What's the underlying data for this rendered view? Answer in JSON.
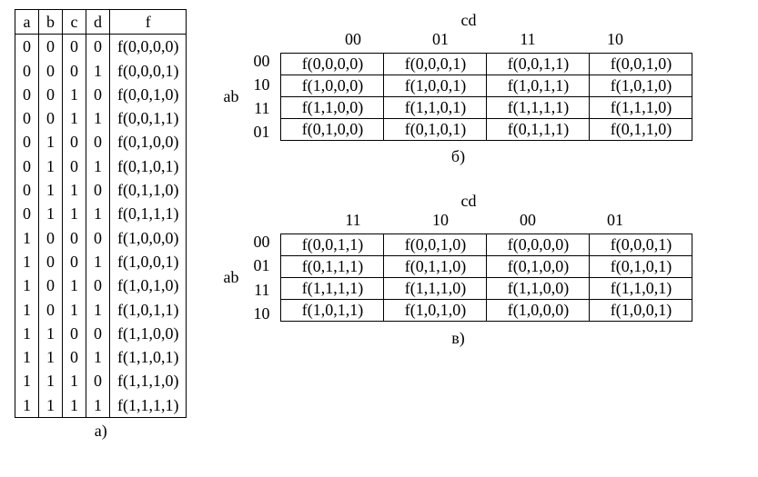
{
  "truth_table": {
    "headers": [
      "a",
      "b",
      "c",
      "d",
      "f"
    ],
    "rows": [
      {
        "a": "0",
        "b": "0",
        "c": "0",
        "d": "0",
        "f": "f(0,0,0,0)"
      },
      {
        "a": "0",
        "b": "0",
        "c": "0",
        "d": "1",
        "f": "f(0,0,0,1)"
      },
      {
        "a": "0",
        "b": "0",
        "c": "1",
        "d": "0",
        "f": "f(0,0,1,0)"
      },
      {
        "a": "0",
        "b": "0",
        "c": "1",
        "d": "1",
        "f": "f(0,0,1,1)"
      },
      {
        "a": "0",
        "b": "1",
        "c": "0",
        "d": "0",
        "f": "f(0,1,0,0)"
      },
      {
        "a": "0",
        "b": "1",
        "c": "0",
        "d": "1",
        "f": "f(0,1,0,1)"
      },
      {
        "a": "0",
        "b": "1",
        "c": "1",
        "d": "0",
        "f": "f(0,1,1,0)"
      },
      {
        "a": "0",
        "b": "1",
        "c": "1",
        "d": "1",
        "f": "f(0,1,1,1)"
      },
      {
        "a": "1",
        "b": "0",
        "c": "0",
        "d": "0",
        "f": "f(1,0,0,0)"
      },
      {
        "a": "1",
        "b": "0",
        "c": "0",
        "d": "1",
        "f": "f(1,0,0,1)"
      },
      {
        "a": "1",
        "b": "0",
        "c": "1",
        "d": "0",
        "f": "f(1,0,1,0)"
      },
      {
        "a": "1",
        "b": "0",
        "c": "1",
        "d": "1",
        "f": "f(1,0,1,1)"
      },
      {
        "a": "1",
        "b": "1",
        "c": "0",
        "d": "0",
        "f": "f(1,1,0,0)"
      },
      {
        "a": "1",
        "b": "1",
        "c": "0",
        "d": "1",
        "f": "f(1,1,0,1)"
      },
      {
        "a": "1",
        "b": "1",
        "c": "1",
        "d": "0",
        "f": "f(1,1,1,0)"
      },
      {
        "a": "1",
        "b": "1",
        "c": "1",
        "d": "1",
        "f": "f(1,1,1,1)"
      }
    ],
    "caption": "а)"
  },
  "kmap_b": {
    "row_var_label": "ab",
    "col_var_label": "cd",
    "col_labels": [
      "00",
      "01",
      "11",
      "10"
    ],
    "row_labels": [
      "00",
      "10",
      "11",
      "01"
    ],
    "cells": [
      [
        "f(0,0,0,0)",
        "f(0,0,0,1)",
        "f(0,0,1,1)",
        "f(0,0,1,0)"
      ],
      [
        "f(1,0,0,0)",
        "f(1,0,0,1)",
        "f(1,0,1,1)",
        "f(1,0,1,0)"
      ],
      [
        "f(1,1,0,0)",
        "f(1,1,0,1)",
        "f(1,1,1,1)",
        "f(1,1,1,0)"
      ],
      [
        "f(0,1,0,0)",
        "f(0,1,0,1)",
        "f(0,1,1,1)",
        "f(0,1,1,0)"
      ]
    ],
    "caption": "б)"
  },
  "kmap_v": {
    "row_var_label": "ab",
    "col_var_label": "cd",
    "col_labels": [
      "11",
      "10",
      "00",
      "01"
    ],
    "row_labels": [
      "00",
      "01",
      "11",
      "10"
    ],
    "cells": [
      [
        "f(0,0,1,1)",
        "f(0,0,1,0)",
        "f(0,0,0,0)",
        "f(0,0,0,1)"
      ],
      [
        "f(0,1,1,1)",
        "f(0,1,1,0)",
        "f(0,1,0,0)",
        "f(0,1,0,1)"
      ],
      [
        "f(1,1,1,1)",
        "f(1,1,1,0)",
        "f(1,1,0,0)",
        "f(1,1,0,1)"
      ],
      [
        "f(1,0,1,1)",
        "f(1,0,1,0)",
        "f(1,0,0,0)",
        "f(1,0,0,1)"
      ]
    ],
    "caption": "в)"
  },
  "chart_data": [
    {
      "type": "table",
      "title": "Truth table (а)",
      "columns": [
        "a",
        "b",
        "c",
        "d",
        "f"
      ],
      "rows": [
        [
          0,
          0,
          0,
          0,
          "f(0,0,0,0)"
        ],
        [
          0,
          0,
          0,
          1,
          "f(0,0,0,1)"
        ],
        [
          0,
          0,
          1,
          0,
          "f(0,0,1,0)"
        ],
        [
          0,
          0,
          1,
          1,
          "f(0,0,1,1)"
        ],
        [
          0,
          1,
          0,
          0,
          "f(0,1,0,0)"
        ],
        [
          0,
          1,
          0,
          1,
          "f(0,1,0,1)"
        ],
        [
          0,
          1,
          1,
          0,
          "f(0,1,1,0)"
        ],
        [
          0,
          1,
          1,
          1,
          "f(0,1,1,1)"
        ],
        [
          1,
          0,
          0,
          0,
          "f(1,0,0,0)"
        ],
        [
          1,
          0,
          0,
          1,
          "f(1,0,0,1)"
        ],
        [
          1,
          0,
          1,
          0,
          "f(1,0,1,0)"
        ],
        [
          1,
          0,
          1,
          1,
          "f(1,0,1,1)"
        ],
        [
          1,
          1,
          0,
          0,
          "f(1,1,0,0)"
        ],
        [
          1,
          1,
          0,
          1,
          "f(1,1,0,1)"
        ],
        [
          1,
          1,
          1,
          0,
          "f(1,1,1,0)"
        ],
        [
          1,
          1,
          1,
          1,
          "f(1,1,1,1)"
        ]
      ]
    },
    {
      "type": "table",
      "title": "Karnaugh map (б)",
      "row_variable": "ab",
      "column_variable": "cd",
      "col_labels": [
        "00",
        "01",
        "11",
        "10"
      ],
      "row_labels": [
        "00",
        "10",
        "11",
        "01"
      ],
      "cells": [
        [
          "f(0,0,0,0)",
          "f(0,0,0,1)",
          "f(0,0,1,1)",
          "f(0,0,1,0)"
        ],
        [
          "f(1,0,0,0)",
          "f(1,0,0,1)",
          "f(1,0,1,1)",
          "f(1,0,1,0)"
        ],
        [
          "f(1,1,0,0)",
          "f(1,1,0,1)",
          "f(1,1,1,1)",
          "f(1,1,1,0)"
        ],
        [
          "f(0,1,0,0)",
          "f(0,1,0,1)",
          "f(0,1,1,1)",
          "f(0,1,1,0)"
        ]
      ]
    },
    {
      "type": "table",
      "title": "Karnaugh map (в)",
      "row_variable": "ab",
      "column_variable": "cd",
      "col_labels": [
        "11",
        "10",
        "00",
        "01"
      ],
      "row_labels": [
        "00",
        "01",
        "11",
        "10"
      ],
      "cells": [
        [
          "f(0,0,1,1)",
          "f(0,0,1,0)",
          "f(0,0,0,0)",
          "f(0,0,0,1)"
        ],
        [
          "f(0,1,1,1)",
          "f(0,1,1,0)",
          "f(0,1,0,0)",
          "f(0,1,0,1)"
        ],
        [
          "f(1,1,1,1)",
          "f(1,1,1,0)",
          "f(1,1,0,0)",
          "f(1,1,0,1)"
        ],
        [
          "f(1,0,1,1)",
          "f(1,0,1,0)",
          "f(1,0,0,0)",
          "f(1,0,0,1)"
        ]
      ]
    }
  ]
}
